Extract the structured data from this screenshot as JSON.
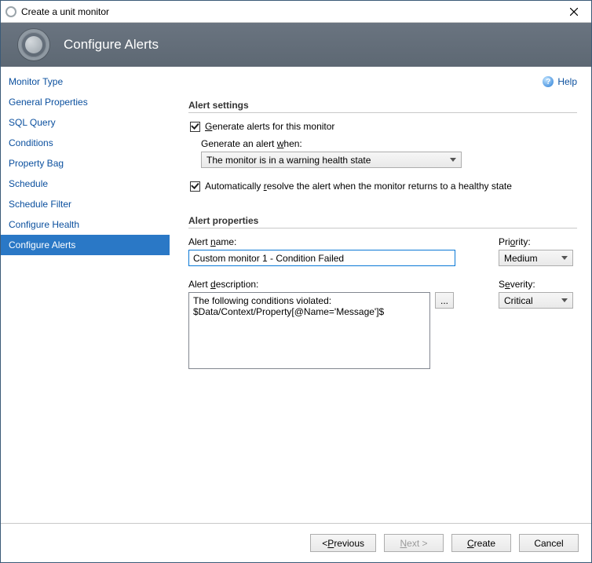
{
  "window": {
    "title": "Create a unit monitor",
    "close_name": "close-icon"
  },
  "banner": {
    "title": "Configure Alerts"
  },
  "help": {
    "label": "Help"
  },
  "sidebar": {
    "items": [
      {
        "label": "Monitor Type"
      },
      {
        "label": "General Properties"
      },
      {
        "label": "SQL Query"
      },
      {
        "label": "Conditions"
      },
      {
        "label": "Property Bag"
      },
      {
        "label": "Schedule"
      },
      {
        "label": "Schedule Filter"
      },
      {
        "label": "Configure Health"
      },
      {
        "label": "Configure Alerts"
      }
    ],
    "selected_index": 8
  },
  "settings": {
    "section_label": "Alert settings",
    "generate_checked": true,
    "generate_prefix": "G",
    "generate_rest": "enerate alerts for this monitor",
    "when_prefix": "Generate an alert ",
    "when_accel": "w",
    "when_suffix": "hen:",
    "when_value": "The monitor is in a warning health state",
    "autoresolve_checked": true,
    "autoresolve_prefix": "Automatically ",
    "autoresolve_accel": "r",
    "autoresolve_suffix": "esolve the alert when the monitor returns to a healthy state"
  },
  "properties": {
    "section_label": "Alert properties",
    "name_prefix": "Alert ",
    "name_accel": "n",
    "name_suffix": "ame:",
    "name_value": "Custom monitor 1 - Condition Failed",
    "priority_prefix": "Pri",
    "priority_accel": "o",
    "priority_suffix": "rity:",
    "priority_value": "Medium",
    "desc_prefix": "Alert ",
    "desc_accel": "d",
    "desc_suffix": "escription:",
    "browse_tip": "...",
    "desc_value": "The following conditions violated:\n$Data/Context/Property[@Name='Message']$",
    "severity_prefix": "S",
    "severity_accel": "e",
    "severity_suffix": "verity:",
    "severity_value": "Critical"
  },
  "footer": {
    "prev_label_pre": "< ",
    "prev_accel": "P",
    "prev_label_post": "revious",
    "next_accel": "N",
    "next_label_post": "ext >",
    "create_accel": "C",
    "create_label_post": "reate",
    "cancel_label": "Cancel"
  }
}
